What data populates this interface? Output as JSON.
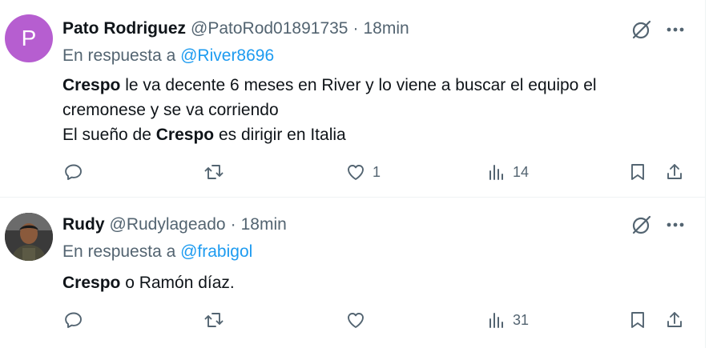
{
  "tweets": [
    {
      "avatar_letter": "P",
      "avatar_color": "#b65ed0",
      "name": "Pato Rodriguez",
      "handle": "@PatoRod01891735",
      "separator": "·",
      "time": "18min",
      "reply_prefix": "En respuesta a",
      "reply_to": "@River8696",
      "body": {
        "line1_bold": "Crespo",
        "line1_rest": " le va decente 6 meses en River y lo viene a buscar el equipo el",
        "line2": "cremonese y se va corriendo",
        "line3_pre": "El sueño de ",
        "line3_bold": "Crespo",
        "line3_post": " es dirigir en Italia"
      },
      "likes": "1",
      "views": "14"
    },
    {
      "name": "Rudy",
      "handle": "@Rudylageado",
      "separator": "·",
      "time": "18min",
      "reply_prefix": "En respuesta a",
      "reply_to": "@frabigol",
      "body": {
        "line1_bold": "Crespo",
        "line1_rest": " o Ramón díaz."
      },
      "views": "31"
    }
  ],
  "icons": {
    "reply": "reply-icon",
    "retweet": "retweet-icon",
    "like": "like-icon",
    "views": "views-icon",
    "bookmark": "bookmark-icon",
    "share": "share-icon",
    "grok": "grok-icon",
    "more": "more-icon"
  },
  "colors": {
    "text": "#0f1419",
    "secondary": "#536471",
    "link": "#1d9bf0",
    "divider": "#eff3f4"
  }
}
